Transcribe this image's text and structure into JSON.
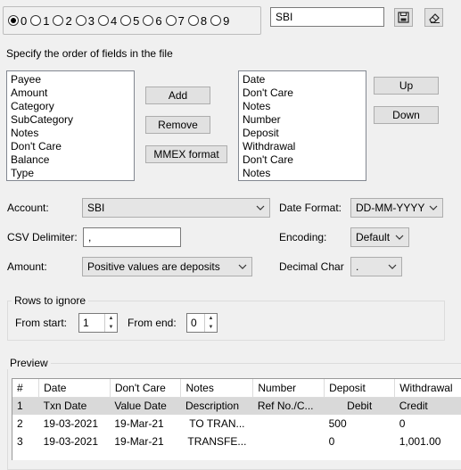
{
  "presets": {
    "options": [
      "0",
      "1",
      "2",
      "3",
      "4",
      "5",
      "6",
      "7",
      "8",
      "9"
    ],
    "selected": "0",
    "name_value": "SBI"
  },
  "icons": {
    "save": "save-icon",
    "clear": "eraser-icon"
  },
  "fields_section": {
    "title": "Specify the order of fields in the file"
  },
  "available_fields": [
    "Payee",
    "Amount",
    "Category",
    "SubCategory",
    "Notes",
    "Don't Care",
    "Balance",
    "Type"
  ],
  "selected_fields": [
    "Date",
    "Don't Care",
    "Notes",
    "Number",
    "Deposit",
    "Withdrawal",
    "Don't Care",
    "Notes"
  ],
  "buttons": {
    "add": "Add",
    "remove": "Remove",
    "mmex": "MMEX format",
    "up": "Up",
    "down": "Down"
  },
  "form": {
    "account_label": "Account:",
    "account_value": "SBI",
    "date_format_label": "Date Format:",
    "date_format_value": "DD-MM-YYYY",
    "csv_delimiter_label": "CSV Delimiter:",
    "csv_delimiter_value": ",",
    "encoding_label": "Encoding:",
    "encoding_value": "Default",
    "amount_label": "Amount:",
    "amount_value": "Positive values are deposits",
    "decimal_char_label": "Decimal Char",
    "decimal_char_value": "."
  },
  "rows_to_ignore": {
    "title": "Rows to ignore",
    "from_start_label": "From start:",
    "from_start_value": "1",
    "from_end_label": "From end:",
    "from_end_value": "0"
  },
  "preview": {
    "title": "Preview",
    "headers": [
      "#",
      "Date",
      "Don't Care",
      "Notes",
      "Number",
      "Deposit",
      "Withdrawal"
    ],
    "rows": [
      [
        "1",
        "Txn Date",
        "Value Date",
        "Description",
        "Ref No./C...",
        "Debit",
        "Credit"
      ],
      [
        "2",
        "19-03-2021",
        "19-Mar-21",
        "TO TRAN...",
        "",
        "500",
        "0"
      ],
      [
        "3",
        "19-03-2021",
        "19-Mar-21",
        "TRANSFE...",
        "",
        "0",
        "1,001.00"
      ]
    ],
    "selected_row": 0
  }
}
